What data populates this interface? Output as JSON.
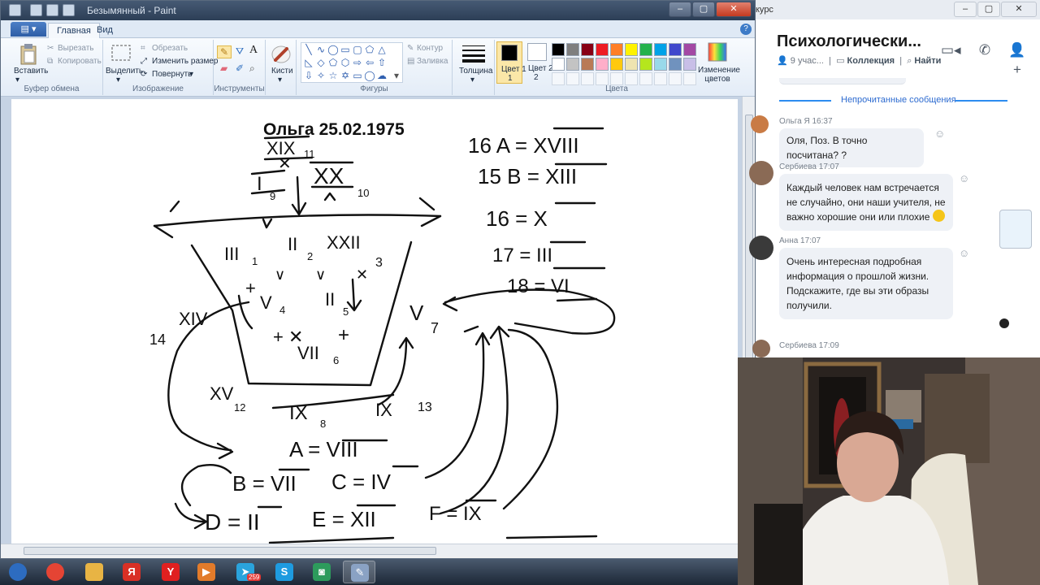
{
  "paint": {
    "title": "Безымянный - Paint",
    "tabs": [
      {
        "label": "Главная"
      },
      {
        "label": "Вид"
      }
    ],
    "clipboard": {
      "paste": "Вставить",
      "cut": "Вырезать",
      "copy": "Копировать",
      "group": "Буфер обмена"
    },
    "image": {
      "select": "Выделить",
      "crop": "Обрезать",
      "resize": "Изменить размер",
      "rotate": "Повернуть",
      "group": "Изображение"
    },
    "tools": {
      "group": "Инструменты"
    },
    "brushes": {
      "label": "Кисти"
    },
    "shapes": {
      "outline": "Контур",
      "fill": "Заливка",
      "group": "Фигуры"
    },
    "size": {
      "label": "Толщина"
    },
    "colors": {
      "color1": "Цвет 1",
      "color2": "Цвет 2",
      "edit": "Изменение цветов",
      "group": "Цвета",
      "palette": [
        "#000000",
        "#7f7f7f",
        "#880015",
        "#ed1c24",
        "#ff7f27",
        "#fff200",
        "#22b14c",
        "#00a2e8",
        "#3f48cc",
        "#a349a4",
        "#ffffff",
        "#c3c3c3",
        "#b97a57",
        "#ffaec9",
        "#ffc90e",
        "#efe4b0",
        "#b5e61d",
        "#99d9ea",
        "#7092be",
        "#c8bfe7"
      ]
    }
  },
  "canvas": {
    "heading": "Ольга 25.02.1975",
    "annotations": {
      "top_xix": "XIX",
      "n11": "11",
      "top_xx": "XX",
      "n10": "10",
      "top_i": "I",
      "n9": "9",
      "iii": "III",
      "n1": "1",
      "ii": "II",
      "n2": "2",
      "xxii": "XXII",
      "n3": "3",
      "v4": "V",
      "n4": "4",
      "ii5": "II",
      "n5": "5",
      "vii6": "VII",
      "n6": "6",
      "v7": "V",
      "n7": "7",
      "xiv": "XIV",
      "n14": "14",
      "xv": "XV",
      "n12": "12",
      "ix8": "IX",
      "n8": "8",
      "ix": "IX",
      "n13": "13",
      "eq_a": "A = VIII",
      "eq_b": "B = VII",
      "eq_c": "C = IV",
      "eq_d": "D = II",
      "eq_e": "E = XII",
      "eq_f": "F = IX",
      "r1": "16  A =  XVIII",
      "r2": "15 B  =  XIII",
      "r3": "16  =  X",
      "r4": "17 =  III",
      "r5": "18 =  VI"
    }
  },
  "chat": {
    "window_fragment": "курс",
    "title": "Психологически...",
    "participants": "9 учас...",
    "collection": "Коллекция",
    "search": "Найти",
    "unread": "Непрочитанные сообщения",
    "messages": [
      {
        "meta": "Ольга Я 16:37",
        "text": "Оля, Поз. В точно посчитана? ?"
      },
      {
        "meta": "Сербиева 17:07",
        "text": "Каждый человек нам встречается не случайно, они наши учителя, не важно хорошие они или плохие"
      },
      {
        "meta": "Анна 17:07",
        "text": "Очень интересная подробная информация о прошлой жизни. Подскажите, где вы эти образы получили."
      },
      {
        "meta": "Сербиева 17:09",
        "text": ""
      }
    ]
  },
  "taskbar": {
    "apps": [
      {
        "name": "start",
        "glyph": "",
        "color": "#2d6cc0"
      },
      {
        "name": "chrome",
        "glyph": "",
        "color": "#e54434"
      },
      {
        "name": "explorer",
        "glyph": "",
        "color": "#e8b444"
      },
      {
        "name": "yandex-browser-ya",
        "glyph": "Я",
        "color": "#d93025"
      },
      {
        "name": "yandex",
        "glyph": "Y",
        "color": "#e02020"
      },
      {
        "name": "media",
        "glyph": "▶",
        "color": "#e27b2a"
      },
      {
        "name": "telegram",
        "glyph": "➤",
        "color": "#2aa3dc"
      },
      {
        "name": "skype",
        "glyph": "S",
        "color": "#1e9be0"
      },
      {
        "name": "app-green",
        "glyph": "◙",
        "color": "#2d9b5c"
      },
      {
        "name": "paint",
        "glyph": "✎",
        "color": "#8aa2c4"
      }
    ],
    "telegram_badge": "259"
  }
}
